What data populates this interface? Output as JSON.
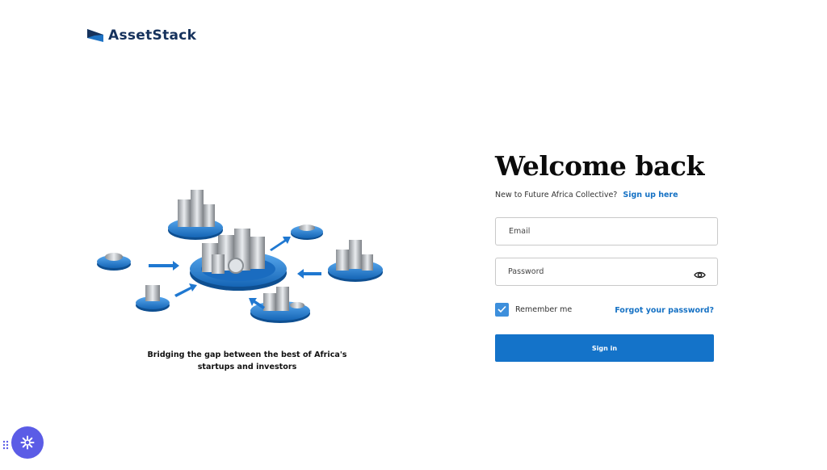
{
  "brand": {
    "name": "AssetStack",
    "color": "#16325c",
    "logo_icon": "flag-icon"
  },
  "hero": {
    "illustration": "coin-stacks-network-illustration",
    "tagline": "Bridging the gap between the best of Africa's startups and investors"
  },
  "login": {
    "title": "Welcome back",
    "prompt": "New to Future Africa Collective?",
    "signup_link": "Sign up here",
    "email_placeholder": "Email",
    "email_value": "",
    "password_placeholder": "Password",
    "password_value": "",
    "password_toggle_icon": "eye-icon",
    "remember_label": "Remember me",
    "remember_checked": true,
    "forgot_link": "Forgot your password?",
    "submit_label": "Sign in"
  },
  "widget": {
    "drag_icon": "drag-dots-icon",
    "button_icon": "sparkle-icon",
    "color": "#5b5ce6"
  },
  "colors": {
    "accent": "#1473c9",
    "link": "#1571c4",
    "checkbox": "#3d8fdc"
  }
}
